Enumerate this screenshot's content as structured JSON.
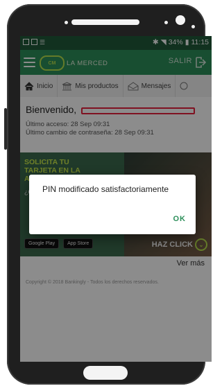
{
  "status_bar": {
    "battery_percent": "34%",
    "time": "11:15"
  },
  "app_bar": {
    "logo_text": "LA MERCED",
    "logo_mark": "CM",
    "exit_label": "SALIR",
    "menu_icon": "hamburger-icon",
    "exit_icon": "exit-icon"
  },
  "tabs": [
    {
      "label": "Inicio",
      "icon": "home-icon"
    },
    {
      "label": "Mis productos",
      "icon": "bank-icon"
    },
    {
      "label": "Mensajes",
      "icon": "envelope-icon"
    }
  ],
  "welcome": {
    "greeting": "Bienvenido,",
    "last_access": "Último acceso: 28 Sep 09:31",
    "last_password_change": "Último cambio de contraseña: 28 Sep 09:31"
  },
  "banner": {
    "title": "SOLICITA TU TARJETA EN LA APP",
    "subtitle": "¿Q",
    "store_google": "Google Play",
    "store_apple": "App Store",
    "cta": "HAZ CLICK"
  },
  "ver_mas": "Ver más",
  "footer": "Copyright © 2018 Bankingly - Todos los derechos reservados.",
  "dialog": {
    "message": "PIN modificado satisfactoriamente",
    "ok_label": "OK"
  },
  "colors": {
    "primary_green": "#2c8f5a",
    "accent_lime": "#b7e04b",
    "status_bar": "#1f5a3a"
  }
}
